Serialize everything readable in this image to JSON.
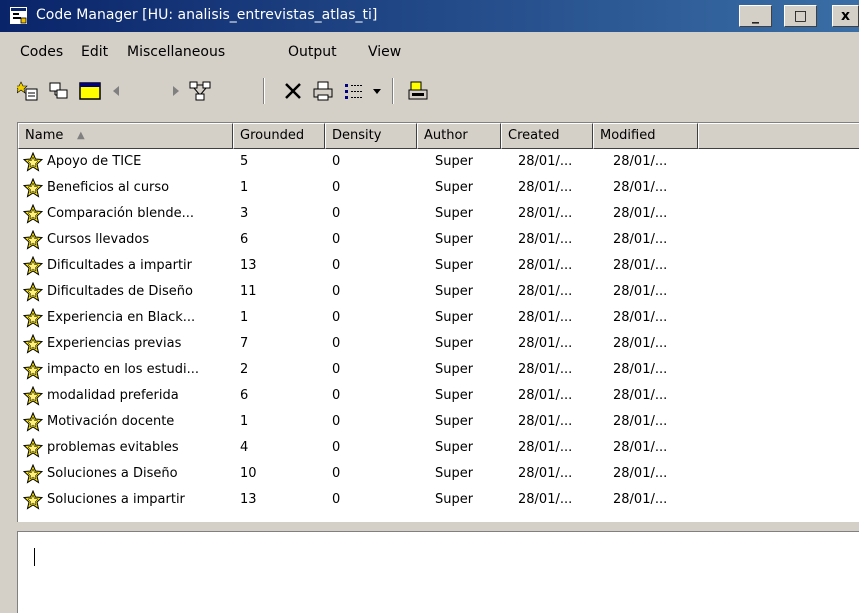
{
  "window": {
    "title": "Code Manager [HU: analisis_entrevistas_atlas_ti]",
    "buttons": {
      "minimize": "_",
      "maximize": "□",
      "close": "x"
    }
  },
  "menu": [
    {
      "label": "Codes"
    },
    {
      "label": "Edit"
    },
    {
      "label": "Miscellaneous"
    },
    {
      "label": "Output"
    },
    {
      "label": "View"
    }
  ],
  "toolbar": {
    "icons": [
      "new-code-icon",
      "code-family-icon",
      "display-icon",
      "back-arrow-icon",
      "forward-arrow-icon",
      "network-icon",
      "delete-icon",
      "print-icon",
      "view-mode-icon",
      "dropdown-icon",
      "export-icon"
    ]
  },
  "columns": [
    {
      "label": "Name"
    },
    {
      "label": "Grounded"
    },
    {
      "label": "Density"
    },
    {
      "label": "Author"
    },
    {
      "label": "Created"
    },
    {
      "label": "Modified"
    }
  ],
  "rows": [
    {
      "name": "Apoyo de TICE",
      "grounded": "5",
      "density": "0",
      "author": "Super",
      "created": "28/01/...",
      "modified": "28/01/..."
    },
    {
      "name": "Beneficios al curso",
      "grounded": "1",
      "density": "0",
      "author": "Super",
      "created": "28/01/...",
      "modified": "28/01/..."
    },
    {
      "name": "Comparación blende...",
      "grounded": "3",
      "density": "0",
      "author": "Super",
      "created": "28/01/...",
      "modified": "28/01/..."
    },
    {
      "name": "Cursos llevados",
      "grounded": "6",
      "density": "0",
      "author": "Super",
      "created": "28/01/...",
      "modified": "28/01/..."
    },
    {
      "name": "Dificultades a impartir",
      "grounded": "13",
      "density": "0",
      "author": "Super",
      "created": "28/01/...",
      "modified": "28/01/..."
    },
    {
      "name": "Dificultades de Diseño",
      "grounded": "11",
      "density": "0",
      "author": "Super",
      "created": "28/01/...",
      "modified": "28/01/..."
    },
    {
      "name": "Experiencia en Black...",
      "grounded": "1",
      "density": "0",
      "author": "Super",
      "created": "28/01/...",
      "modified": "28/01/..."
    },
    {
      "name": "Experiencias previas",
      "grounded": "7",
      "density": "0",
      "author": "Super",
      "created": "28/01/...",
      "modified": "28/01/..."
    },
    {
      "name": "impacto en los estudi...",
      "grounded": "2",
      "density": "0",
      "author": "Super",
      "created": "28/01/...",
      "modified": "28/01/..."
    },
    {
      "name": "modalidad preferida",
      "grounded": "6",
      "density": "0",
      "author": "Super",
      "created": "28/01/...",
      "modified": "28/01/..."
    },
    {
      "name": "Motivación docente",
      "grounded": "1",
      "density": "0",
      "author": "Super",
      "created": "28/01/...",
      "modified": "28/01/..."
    },
    {
      "name": "problemas evitables",
      "grounded": "4",
      "density": "0",
      "author": "Super",
      "created": "28/01/...",
      "modified": "28/01/..."
    },
    {
      "name": "Soluciones a Diseño",
      "grounded": "10",
      "density": "0",
      "author": "Super",
      "created": "28/01/...",
      "modified": "28/01/..."
    },
    {
      "name": "Soluciones a impartir",
      "grounded": "13",
      "density": "0",
      "author": "Super",
      "created": "28/01/...",
      "modified": "28/01/..."
    }
  ],
  "memo": {
    "value": ""
  }
}
